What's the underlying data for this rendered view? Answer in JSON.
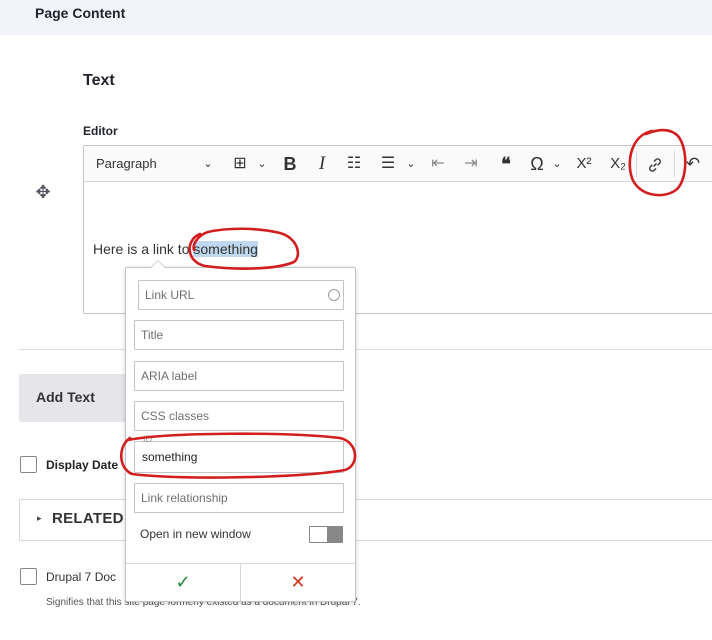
{
  "header": {
    "title": "Page Content"
  },
  "paragraph": {
    "title": "Text",
    "editor_label": "Editor",
    "drag_glyph": "✥"
  },
  "toolbar": {
    "paragraph_label": "Paragraph",
    "items": [
      {
        "name": "source-icon",
        "glyph": "⊞"
      },
      {
        "name": "bold-button",
        "glyph": "B"
      },
      {
        "name": "italic-button",
        "glyph": "I"
      },
      {
        "name": "bulleted-list-icon",
        "glyph": "☷"
      },
      {
        "name": "numbered-list-icon",
        "glyph": "☰"
      },
      {
        "name": "outdent-icon",
        "glyph": "⇤"
      },
      {
        "name": "indent-icon",
        "glyph": "⇥"
      },
      {
        "name": "blockquote-icon",
        "glyph": "❝"
      },
      {
        "name": "special-chars-icon",
        "glyph": "Ω"
      },
      {
        "name": "superscript-icon",
        "glyph": "X²"
      },
      {
        "name": "subscript-icon",
        "glyph": "X₂"
      },
      {
        "name": "link-icon",
        "glyph": "🔗"
      },
      {
        "name": "undo-icon",
        "glyph": "↶"
      }
    ]
  },
  "editor": {
    "text_before": "Here is a link to ",
    "selected_text": "something"
  },
  "link_balloon": {
    "url_placeholder": "Link URL",
    "title_placeholder": "Title",
    "aria_placeholder": "ARIA label",
    "css_placeholder": "CSS classes",
    "id_label": "ID",
    "id_value": "something",
    "rel_placeholder": "Link relationship",
    "new_window_label": "Open in new window",
    "save_glyph": "✓",
    "cancel_glyph": "✕"
  },
  "page": {
    "add_text_label": "Add Text",
    "display_date_label": "Display Date",
    "related_title": "RELATED",
    "drupal7_label": "Drupal 7 Doc",
    "drupal7_desc": "Signifies that this site page formerly existed as a document in Drupal 7."
  },
  "colors": {
    "annotation_red": "#d21e1e",
    "selection": "#bed9ef",
    "save_green": "#1e8c3a",
    "cancel_red": "#d0341f"
  }
}
